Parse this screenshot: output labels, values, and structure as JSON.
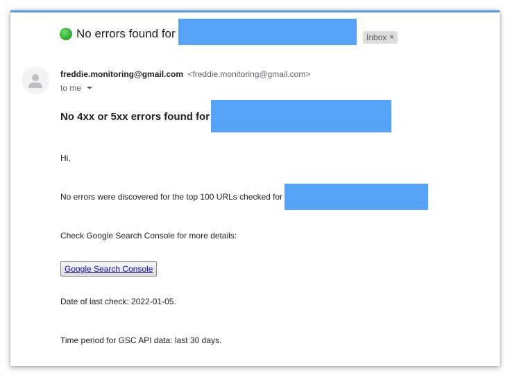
{
  "subject": {
    "status_icon": "green-circle",
    "text": "No errors found for"
  },
  "labels": {
    "inbox": "Inbox",
    "close_glyph": "×"
  },
  "sender": {
    "name": "freddie.monitoring@gmail.com",
    "email": "<freddie.monitoring@gmail.com>",
    "to": "to me"
  },
  "body": {
    "heading": "No 4xx or 5xx errors found for",
    "greeting": "Hi,",
    "line1": "No errors were discovered for the top 100 URLs checked for",
    "line2": "Check Google Search Console for more details:",
    "button_label": "Google Search Console",
    "date_line": "Date of last check: 2022-01-05.",
    "period_line": "Time period for GSC API data: last 30 days."
  },
  "colors": {
    "redaction": "#55a2f6",
    "accent": "#5b9bd5",
    "status_green": "#2aa52a"
  }
}
